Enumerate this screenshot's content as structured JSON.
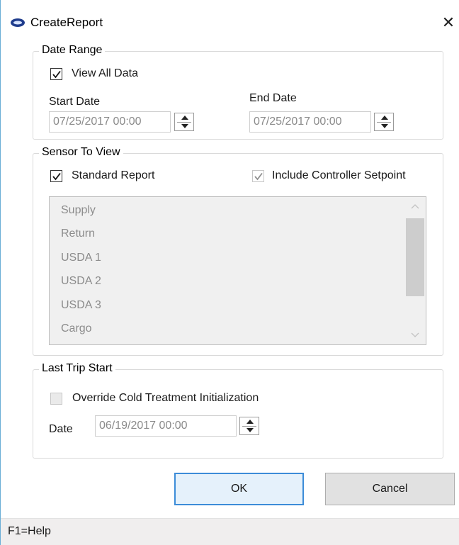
{
  "window": {
    "title": "CreateReport",
    "close_glyph": "✕"
  },
  "date_range": {
    "legend": "Date Range",
    "view_all_label": "View All Data",
    "view_all_checked": true,
    "start_label": "Start Date",
    "start_value": "07/25/2017 00:00",
    "end_label": "End Date",
    "end_value": "07/25/2017 00:00"
  },
  "sensor": {
    "legend": "Sensor To View",
    "standard_report_label": "Standard Report",
    "standard_report_checked": true,
    "include_setpoint_label": "Include Controller Setpoint",
    "include_setpoint_checked": true,
    "items": [
      "Supply",
      "Return",
      "USDA 1",
      "USDA 2",
      "USDA 3",
      "Cargo"
    ]
  },
  "last_trip": {
    "legend": "Last Trip Start",
    "override_label": "Override Cold Treatment Initialization",
    "override_checked": false,
    "date_label": "Date",
    "date_value": "06/19/2017 00:00"
  },
  "buttons": {
    "ok": "OK",
    "cancel": "Cancel"
  },
  "status": {
    "help": "F1=Help"
  },
  "colors": {
    "accent": "#3c8cd8",
    "disabled_text": "#8c8c8c"
  },
  "icons": [
    "app-logo-icon",
    "close-icon",
    "checkmark-icon",
    "spin-up-icon",
    "spin-down-icon",
    "scroll-up-icon",
    "scroll-down-icon"
  ]
}
